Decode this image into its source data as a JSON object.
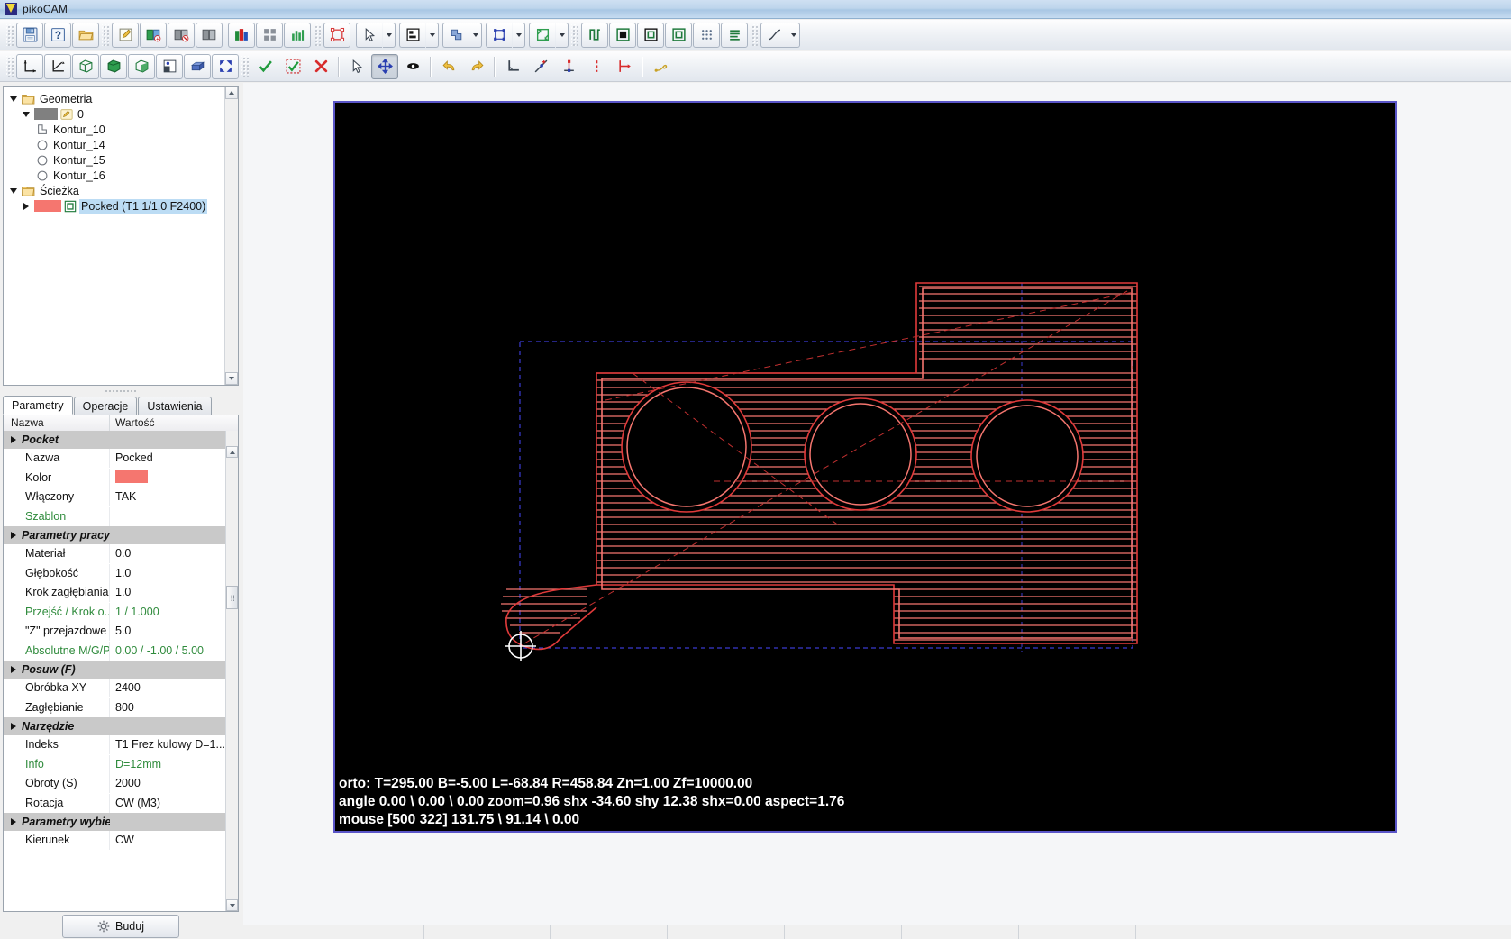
{
  "window": {
    "title": "pikoCAM",
    "logo_icon": "piko-logo-icon"
  },
  "toolbar_row1": [
    {
      "name": "save-button",
      "icon": "floppy-disk-icon",
      "label": "Zapisz"
    },
    {
      "name": "help-button",
      "icon": "question-mark-icon",
      "label": "Pomoc"
    },
    {
      "name": "open-button",
      "icon": "open-folder-icon",
      "label": "Otwórz"
    },
    {
      "name": "edit-note-button",
      "icon": "pencil-note-icon",
      "label": "Edytuj"
    },
    {
      "name": "layer-add-button",
      "icon": "layer-add-icon",
      "label": "Dodaj warstwę"
    },
    {
      "name": "layer-delete-button",
      "icon": "layer-delete-icon",
      "label": "Usuń warstwę"
    },
    {
      "name": "layer-copy-button",
      "icon": "layer-copy-icon",
      "label": "Kopiuj warstwę"
    },
    {
      "name": "colors-button",
      "icon": "color-blocks-icon",
      "label": "Kolory"
    },
    {
      "name": "grid-view-button",
      "icon": "grid-squares-icon",
      "label": "Widok siatki"
    },
    {
      "name": "chart-button",
      "icon": "bar-chart-icon",
      "label": "Wykres"
    },
    {
      "name": "bounds-button",
      "icon": "selection-bounds-icon",
      "label": "Obrys"
    },
    {
      "name": "select-tool-button",
      "icon": "cursor-arrow-icon",
      "label": "Zaznacz",
      "dropdown": true
    },
    {
      "name": "align-tool-button",
      "icon": "align-objects-icon",
      "label": "Wyrównaj",
      "dropdown": true
    },
    {
      "name": "boolean-tool-button",
      "icon": "boolean-shape-icon",
      "label": "Operacje logiczne",
      "dropdown": true
    },
    {
      "name": "transform-tool-button",
      "icon": "transform-handles-icon",
      "label": "Transformacja",
      "dropdown": true
    },
    {
      "name": "resize-tool-button",
      "icon": "resize-arrows-icon",
      "label": "Skaluj",
      "dropdown": true
    },
    {
      "name": "profile-path-button",
      "icon": "profile-path-icon",
      "label": "Profil"
    },
    {
      "name": "pocket-fill-button",
      "icon": "pocket-filled-icon",
      "label": "Kieszeń"
    },
    {
      "name": "pocket-outline-button",
      "icon": "pocket-outline-icon",
      "label": "Kieszeń kontur"
    },
    {
      "name": "pocket-green-button",
      "icon": "pocket-green-icon",
      "label": "Kieszeń zielona"
    },
    {
      "name": "drill-grid-button",
      "icon": "drill-dots-icon",
      "label": "Wiercenie"
    },
    {
      "name": "raster-lines-button",
      "icon": "raster-lines-icon",
      "label": "Raster"
    },
    {
      "name": "curve-tool-button",
      "icon": "curve-line-icon",
      "label": "Krzywa",
      "dropdown": true
    }
  ],
  "toolbar_row2": [
    {
      "name": "axis-origin-button",
      "icon": "axis-origin-icon",
      "label": "Układ bazowy"
    },
    {
      "name": "axis-rotate-button",
      "icon": "axis-rotate-icon",
      "label": "Obrót układu"
    },
    {
      "name": "view-iso-button",
      "icon": "cube-wire-icon",
      "label": "Widok ISO"
    },
    {
      "name": "view-solid-button",
      "icon": "cube-solid-icon",
      "label": "Widok bryłowy"
    },
    {
      "name": "view-section-button",
      "icon": "cube-section-icon",
      "label": "Przekrój"
    },
    {
      "name": "simulate-button",
      "icon": "simulation-icon",
      "label": "Symulacja"
    },
    {
      "name": "stock-button",
      "icon": "stock-block-icon",
      "label": "Materiał"
    },
    {
      "name": "fit-view-button",
      "icon": "fit-screen-icon",
      "label": "Dopasuj"
    },
    {
      "name": "accept-button",
      "icon": "check-green-icon",
      "label": "Zatwierdź"
    },
    {
      "name": "accept-all-button",
      "icon": "check-dashed-icon",
      "label": "Zatwierdź wszystko"
    },
    {
      "name": "cancel-button",
      "icon": "cross-red-icon",
      "label": "Anuluj"
    },
    {
      "name": "pointer-button",
      "icon": "cursor-arrow-icon",
      "label": "Wskaźnik"
    },
    {
      "name": "move-button",
      "icon": "move-cross-icon",
      "label": "Przesuń",
      "active": true
    },
    {
      "name": "node-edit-button",
      "icon": "node-handle-icon",
      "label": "Edycja węzłów"
    },
    {
      "name": "undo-button",
      "icon": "undo-arrow-icon",
      "label": "Cofnij"
    },
    {
      "name": "redo-button",
      "icon": "redo-arrow-icon",
      "label": "Ponów"
    },
    {
      "name": "measure-angle-button",
      "icon": "angle-measure-icon",
      "label": "Kąt"
    },
    {
      "name": "snap-point-button",
      "icon": "snap-point-icon",
      "label": "Przyciąganie do punktu"
    },
    {
      "name": "snap-perp-button",
      "icon": "snap-perpendicular-icon",
      "label": "Prostopadłość"
    },
    {
      "name": "dimension-v-button",
      "icon": "dimension-vertical-icon",
      "label": "Wymiar pionowy"
    },
    {
      "name": "dimension-h-button",
      "icon": "dimension-horizontal-icon",
      "label": "Wymiar poziomy"
    },
    {
      "name": "measure-tool-button",
      "icon": "measure-tape-icon",
      "label": "Miara"
    }
  ],
  "tree": {
    "nodes": [
      {
        "label": "Geometria",
        "icon": "folder-icon",
        "level": 1,
        "expanded": true,
        "twisty": "open"
      },
      {
        "label": "0",
        "icon": "pencil-layer-icon",
        "level": 2,
        "expanded": true,
        "twisty": "open",
        "swatch": "gray"
      },
      {
        "label": "Kontur_10",
        "icon": "polyline-shape-icon",
        "level": 3
      },
      {
        "label": "Kontur_14",
        "icon": "circle-shape-icon",
        "level": 3
      },
      {
        "label": "Kontur_15",
        "icon": "circle-shape-icon",
        "level": 3
      },
      {
        "label": "Kontur_16",
        "icon": "circle-shape-icon",
        "level": 3
      },
      {
        "label": "Ścieżka",
        "icon": "folder-icon",
        "level": 1,
        "expanded": true,
        "twisty": "open"
      },
      {
        "label": "Pocked (T1 1/1.0 F2400)",
        "icon": "pocket-path-icon",
        "level": 2,
        "twisty": "closed",
        "swatch": "salmon",
        "selected": true
      }
    ]
  },
  "tabs": [
    {
      "label": "Parametry",
      "active": true,
      "name": "tab-parametry"
    },
    {
      "label": "Operacje",
      "active": false,
      "name": "tab-operacje"
    },
    {
      "label": "Ustawienia",
      "active": false,
      "name": "tab-ustawienia"
    }
  ],
  "property_table": {
    "headers": {
      "name": "Nazwa",
      "value": "Wartość"
    },
    "rows": [
      {
        "type": "group",
        "name": "Pocket",
        "value": ""
      },
      {
        "type": "item",
        "name": "Nazwa",
        "value": "Pocked"
      },
      {
        "type": "color",
        "name": "Kolor",
        "value": "",
        "color": "#f5766f"
      },
      {
        "type": "item",
        "name": "Włączony",
        "value": "TAK"
      },
      {
        "type": "item",
        "name": "Szablon",
        "value": "",
        "green": true
      },
      {
        "type": "group",
        "name": "Parametry pracy",
        "value": ""
      },
      {
        "type": "item",
        "name": "Materiał",
        "value": "0.0"
      },
      {
        "type": "item",
        "name": "Głębokość",
        "value": "1.0"
      },
      {
        "type": "item",
        "name": "Krok zagłębiania",
        "value": "1.0"
      },
      {
        "type": "item",
        "name": "Przejść / Krok o...",
        "value": "1 / 1.000",
        "green": true
      },
      {
        "type": "item",
        "name": "\"Z\" przejazdowe",
        "value": "5.0"
      },
      {
        "type": "item",
        "name": "Absolutne M/G/P",
        "value": "0.00 / -1.00 / 5.00",
        "green": true
      },
      {
        "type": "group",
        "name": "Posuw (F)",
        "value": ""
      },
      {
        "type": "item",
        "name": "Obróbka XY",
        "value": "2400"
      },
      {
        "type": "item",
        "name": "Zagłębianie",
        "value": "800"
      },
      {
        "type": "group",
        "name": "Narzędzie",
        "value": ""
      },
      {
        "type": "item",
        "name": "Indeks",
        "value": "T1 Frez kulowy D=1..."
      },
      {
        "type": "item",
        "name": "Info",
        "value": "D=12mm",
        "green": true
      },
      {
        "type": "item",
        "name": "Obroty (S)",
        "value": "2000"
      },
      {
        "type": "item",
        "name": "Rotacja",
        "value": "CW (M3)"
      },
      {
        "type": "group",
        "name": "Parametry wybierania",
        "value": ""
      },
      {
        "type": "item",
        "name": "Kierunek",
        "value": "CW"
      }
    ]
  },
  "build_button": {
    "label": "Buduj",
    "icon": "gear-icon"
  },
  "viewport": {
    "status_lines": [
      "orto: T=295.00 B=-5.00 L=-68.84 R=458.84 Zn=1.00 Zf=10000.00",
      "angle 0.00 \\ 0.00 \\ 0.00  zoom=0.96  shx -34.60 shy 12.38 shx=0.00 aspect=1.76",
      "mouse [500 322] 131.75 \\ 91.14 \\ 0.00"
    ],
    "colors": {
      "background": "#000000",
      "toolpath": "#f5766f",
      "geometry": "#e03a3a",
      "stock_outline": "#3b3bd0",
      "border": "#5a55c8"
    }
  }
}
